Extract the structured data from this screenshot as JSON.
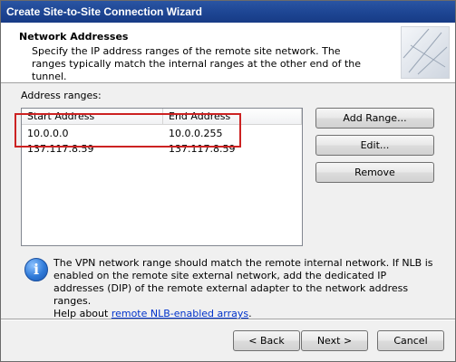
{
  "window": {
    "title": "Create Site-to-Site Connection Wizard"
  },
  "header": {
    "title": "Network Addresses",
    "description": "Specify the IP address ranges of the remote site network. The ranges typically match the internal ranges at the other end of the tunnel."
  },
  "address_ranges": {
    "label": "Address ranges:",
    "columns": [
      "Start Address",
      "End Address"
    ],
    "rows": [
      [
        "10.0.0.0",
        "10.0.0.255"
      ],
      [
        "137.117.8.59",
        "137.117.8.59"
      ]
    ]
  },
  "side_buttons": {
    "add": "Add Range...",
    "edit": "Edit...",
    "remove": "Remove"
  },
  "info": {
    "text": "The VPN network range should match the remote internal network. If NLB is enabled on the remote site external network, add the dedicated IP addresses (DIP) of the remote external adapter to the network address ranges.",
    "help_prefix": "Help about ",
    "help_link": "remote NLB-enabled arrays",
    "help_suffix": "."
  },
  "footer": {
    "back": "< Back",
    "next": "Next >",
    "cancel": "Cancel"
  },
  "colors": {
    "titlebar": "#1d4593",
    "highlight": "#cc2222",
    "link": "#0033cc"
  }
}
